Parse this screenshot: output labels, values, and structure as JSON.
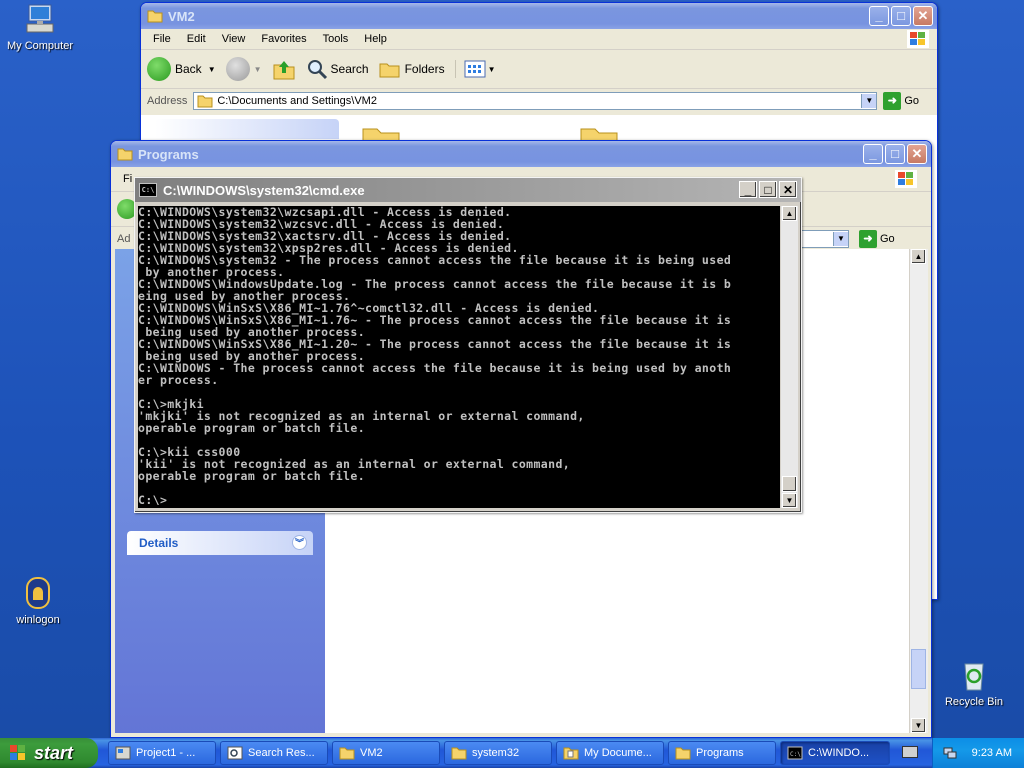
{
  "desktop": {
    "icons": [
      {
        "label": "My Computer"
      },
      {
        "label": "winlogon"
      },
      {
        "label": "Recycle Bin"
      }
    ]
  },
  "vm2_window": {
    "title": "VM2",
    "menu": [
      "File",
      "Edit",
      "View",
      "Favorites",
      "Tools",
      "Help"
    ],
    "toolbar": {
      "back": "Back",
      "search": "Search",
      "folders": "Folders"
    },
    "address_label": "Address",
    "address_value": "C:\\Documents and Settings\\VM2",
    "go": "Go"
  },
  "programs_window": {
    "title": "Programs",
    "menu_first": "Fi",
    "address_label": "Ad",
    "go": "Go",
    "details_label": "Details"
  },
  "cmd_window": {
    "title": "C:\\WINDOWS\\system32\\cmd.exe",
    "output": "C:\\WINDOWS\\system32\\wzcsapi.dll - Access is denied.\nC:\\WINDOWS\\system32\\wzcsvc.dll - Access is denied.\nC:\\WINDOWS\\system32\\xactsrv.dll - Access is denied.\nC:\\WINDOWS\\system32\\xpsp2res.dll - Access is denied.\nC:\\WINDOWS\\system32 - The process cannot access the file because it is being used\n by another process.\nC:\\WINDOWS\\WindowsUpdate.log - The process cannot access the file because it is b\neing used by another process.\nC:\\WINDOWS\\WinSxS\\X86_MI~1.76^~comctl32.dll - Access is denied.\nC:\\WINDOWS\\WinSxS\\X86_MI~1.76~ - The process cannot access the file because it is\n being used by another process.\nC:\\WINDOWS\\WinSxS\\X86_MI~1.20~ - The process cannot access the file because it is\n being used by another process.\nC:\\WINDOWS - The process cannot access the file because it is being used by anoth\ner process.\n\nC:\\>mkjki\n'mkjki' is not recognized as an internal or external command,\noperable program or batch file.\n\nC:\\>kii css000\n'kii' is not recognized as an internal or external command,\noperable program or batch file.\n\nC:\\>"
  },
  "taskbar": {
    "start": "start",
    "items": [
      {
        "label": "Project1 - ..."
      },
      {
        "label": "Search Res..."
      },
      {
        "label": "VM2"
      },
      {
        "label": "system32"
      },
      {
        "label": "My Docume..."
      },
      {
        "label": "Programs"
      },
      {
        "label": "C:\\WINDO..."
      }
    ],
    "clock": "9:23 AM"
  },
  "colors": {
    "title_active": "#0053ee",
    "desktop": "#1d52b8",
    "start_green": "#3c9c3c",
    "console_bg": "#000000",
    "console_fg": "#c0c0c0"
  }
}
